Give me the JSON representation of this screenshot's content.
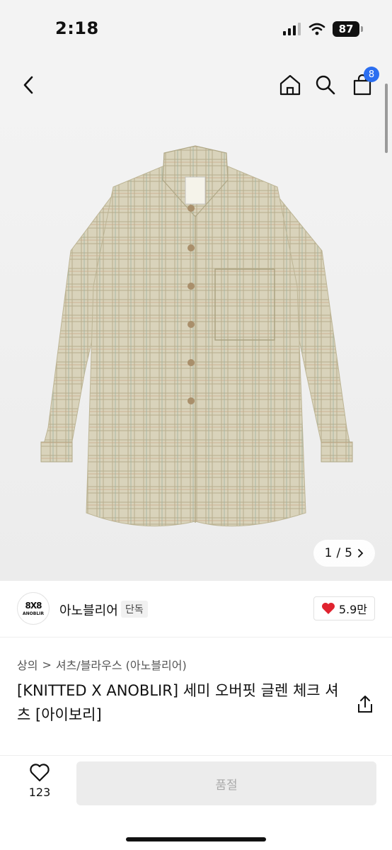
{
  "status_bar": {
    "time": "2:18",
    "battery": "87"
  },
  "header": {
    "cart_badge": "8"
  },
  "gallery": {
    "current": "1",
    "separator": "/",
    "total": "5"
  },
  "brand": {
    "name": "아노블리어",
    "logo_mark": "8X8",
    "logo_text": "ANOBLIR",
    "badge": "단독",
    "likes": "5.9만"
  },
  "breadcrumb": {
    "category": "상의",
    "separator": ">",
    "subcategory": "셔츠/블라우스 (아노블리어)"
  },
  "product": {
    "title": "[KNITTED X ANOBLIR] 세미 오버핏 글렌 체크 셔츠 [아이보리]"
  },
  "bottom_bar": {
    "wishlist_count": "123",
    "soldout_label": "품절"
  },
  "colors": {
    "accent": "#2b6ef0",
    "heart": "#e0232f",
    "shirt": "#d9d3bb"
  }
}
